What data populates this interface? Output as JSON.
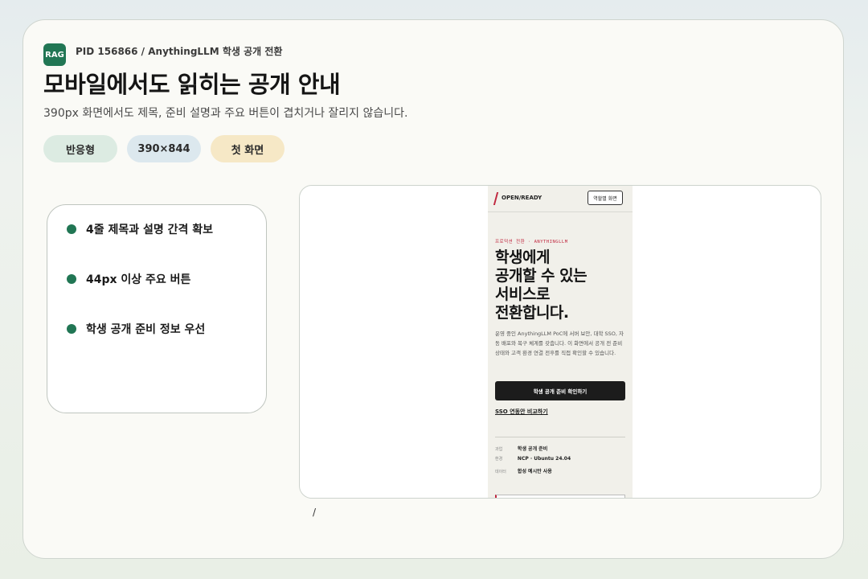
{
  "header": {
    "badge": "RAG",
    "pid": "PID 156866 / AnythingLLM 학생 공개 전환",
    "title": "모바일에서도 읽히는 공개 안내",
    "subtitle": "390px 화면에서도 제목, 준비 설명과 주요 버튼이 겹치거나 잘리지 않습니다."
  },
  "chips": [
    "반응형",
    "390×844",
    "첫 화면"
  ],
  "checklist": [
    "4줄 제목과 설명 간격 확보",
    "44px 이상 주요 버튼",
    "학생 공개 준비 정보 우선"
  ],
  "phone": {
    "brand": "OPEN/READY",
    "role_button": "역할별 화면",
    "eyebrow": "프로덕션 전환 · ANYTHINGLLM",
    "hero_lines": [
      "학생에게",
      "공개할 수 있는",
      "서비스로",
      "전환합니다."
    ],
    "description": "운영 중인 AnythingLLM PoC에 서버 보안, 대학 SSO, 자동 배포와 복구 체계를 갖춥니다. 이 화면에서 공개 전 준비 상태와 고객 환경 연결 전후를 직접 확인할 수 있습니다.",
    "primary_button": "학생 공개 준비 확인하기",
    "secondary_link": "SSO 연동안 비교하기",
    "info_rows": [
      {
        "key": "과업",
        "value": "학생 공개 준비"
      },
      {
        "key": "환경",
        "value": "NCP · Ubuntu 24.04"
      },
      {
        "key": "데이터",
        "value": "합성 예시만 사용"
      }
    ]
  },
  "caption": "/",
  "colors": {
    "accent": "#217654",
    "brand_red": "#c0273f",
    "chip_green": "#dcebe2",
    "chip_blue": "#dce8ee",
    "chip_yellow": "#f6e8c6"
  }
}
